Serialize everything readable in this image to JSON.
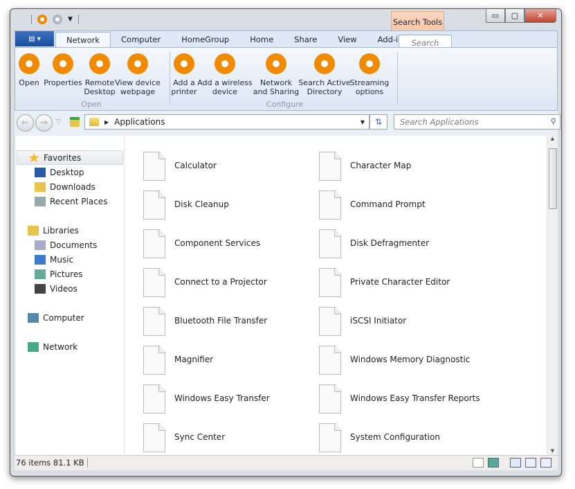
{
  "titlebar": {
    "context_tab": "Search Tools",
    "minimize": "▭",
    "maximize": "▢",
    "close": "✕"
  },
  "tabs": [
    "Network",
    "Computer",
    "HomeGroup",
    "Home",
    "Share",
    "View",
    "Add-ins"
  ],
  "search_tab": "Search",
  "ribbon": {
    "open_group": {
      "label": "Open",
      "buttons": [
        "Open",
        "Properties",
        "Remote\nDesktop",
        "View device\nwebpage"
      ]
    },
    "configure_group": {
      "label": "Configure",
      "buttons": [
        "Add a\nprinter",
        "Add a wireless\ndevice",
        "Network\nand Sharing",
        "Search Active\nDirectory",
        "Streaming\noptions"
      ]
    }
  },
  "address": {
    "path": "Applications",
    "search_placeholder": "Search Applications"
  },
  "navpane": {
    "favorites": "Favorites",
    "fav_items": [
      "Desktop",
      "Downloads",
      "Recent Places"
    ],
    "libraries": "Libraries",
    "lib_items": [
      "Documents",
      "Music",
      "Pictures",
      "Videos"
    ],
    "computer": "Computer",
    "network": "Network"
  },
  "items_left": [
    "Calculator",
    "Disk Cleanup",
    "Component Services",
    "Connect to a Projector",
    "Bluetooth File Transfer",
    "Magnifier",
    "Windows Easy Transfer",
    "Sync Center"
  ],
  "items_right": [
    "Character Map",
    "Command Prompt",
    "Disk Defragmenter",
    "Private Character Editor",
    "iSCSI Initiator",
    "Windows Memory Diagnostic",
    "Windows Easy Transfer Reports",
    "System Configuration"
  ],
  "status": {
    "text": "76 items  81.1 KB"
  },
  "colors": {
    "accent": "#f08a00",
    "ribbon": "#dce6f3"
  }
}
